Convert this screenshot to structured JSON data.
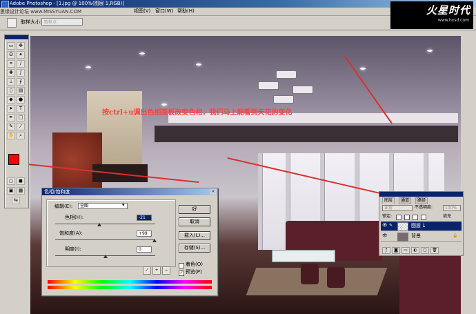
{
  "window": {
    "title": "Adobe Photoshop - [1.jpg @ 100%(图层 1,RGB)]"
  },
  "watermark": "思缘设计论坛 www.MISSYUAN.COM",
  "menu": {
    "items": [
      "视图(V)",
      "窗口(W)",
      "帮助(H)"
    ]
  },
  "options": {
    "sample_label": "取样大小:",
    "sample_value": "取样点"
  },
  "brand": {
    "logo": "火星时代",
    "url": "www.hxsd.com"
  },
  "annotation": "按ctrl+u调出色相面板改变色相，我们马上能看到天花的变化",
  "dialog": {
    "title": "色相/饱和度",
    "edit_label": "编辑(E):",
    "edit_value": "全图",
    "hue_label": "色相(H):",
    "hue_value": "-21",
    "hue_level": 0.44,
    "sat_label": "饱和度(A):",
    "sat_value": "+99",
    "sat_level": 0.995,
    "light_label": "明度(I):",
    "light_value": "0",
    "light_level": 0.5,
    "ok": "好",
    "cancel": "取消",
    "load": "载入(L)...",
    "save": "存储(S)...",
    "colorize": "着色(O)",
    "preview": "预览(P)",
    "colorize_checked": false,
    "preview_checked": true
  },
  "layers": {
    "tabs": [
      "图层",
      "通道",
      "路径"
    ],
    "blend": "正常",
    "opacity_label": "不透明度:",
    "opacity_value": "100%",
    "lock_label": "锁定:",
    "fill_label": "填充",
    "rows": [
      {
        "name": "图层 1",
        "selected": true
      },
      {
        "name": "背景",
        "selected": false
      }
    ]
  },
  "colors": {
    "foreground": "#ff0000",
    "background": "#ffffff",
    "annotation": "#ff4040",
    "selection": "#0a246a"
  }
}
